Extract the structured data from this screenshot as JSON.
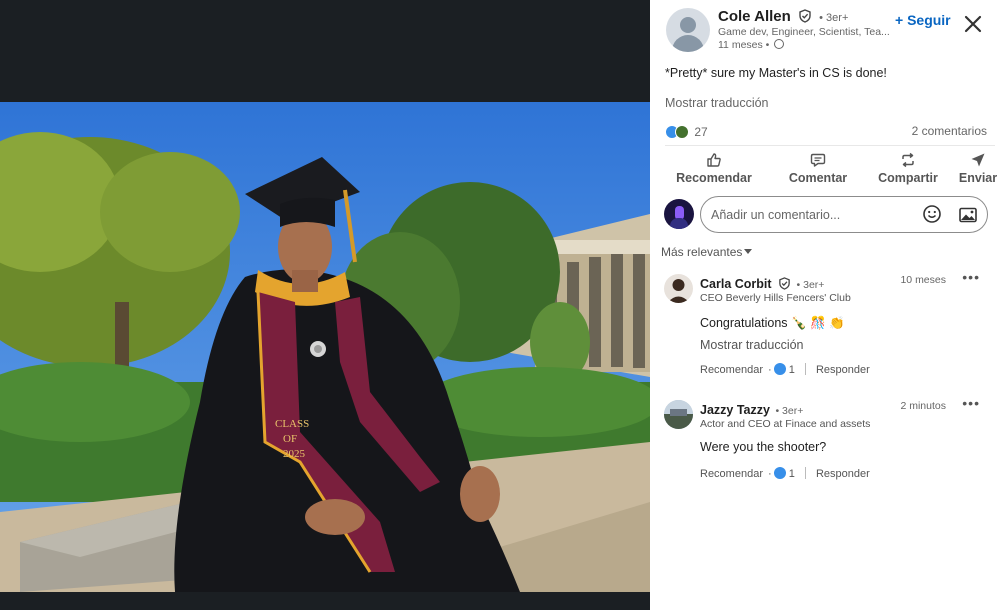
{
  "post": {
    "author_name": "Cole Allen",
    "author_degree": "• 3er+",
    "author_headline": "Game dev, Engineer, Scientist, Tea...",
    "author_time": "11 meses •",
    "follow_label": "+ Seguir",
    "text": "*Pretty* sure my Master's in CS is done!",
    "translate_label": "Mostrar traducción",
    "reactions_count": "27",
    "comments_count": "2 comentarios"
  },
  "actions": [
    {
      "label": "Recomendar",
      "icon": "thumbs-up-icon"
    },
    {
      "label": "Comentar",
      "icon": "comment-icon"
    },
    {
      "label": "Compartir",
      "icon": "repost-icon"
    },
    {
      "label": "Enviar",
      "icon": "send-icon"
    }
  ],
  "comment_box": {
    "placeholder": "Añadir un comentario..."
  },
  "sort_label": "Más relevantes",
  "comments": [
    {
      "name": "Carla Corbit",
      "degree": "• 3er+",
      "headline": "CEO Beverly Hills Fencers' Club",
      "time": "10 meses",
      "text": "Congratulations 🍾 🎊 👏",
      "translate_label": "Mostrar traducción",
      "like_label": "Recomendar",
      "reaction_count": "1",
      "reply_label": "Responder"
    },
    {
      "name": "Jazzy Tazzy",
      "degree": "• 3er+",
      "headline": "Actor and CEO at Finace and assets",
      "time": "2 minutos",
      "text": "Were you the shooter?",
      "like_label": "Recomendar",
      "reaction_count": "1",
      "reply_label": "Responder"
    }
  ],
  "photo": {
    "stole_text": [
      "CLASS",
      "OF",
      "2025"
    ]
  },
  "colors": {
    "accent": "#0a66c2",
    "like": "#378fe9",
    "panel_bg": "#ffffff",
    "media_bg": "#1b1f23"
  }
}
